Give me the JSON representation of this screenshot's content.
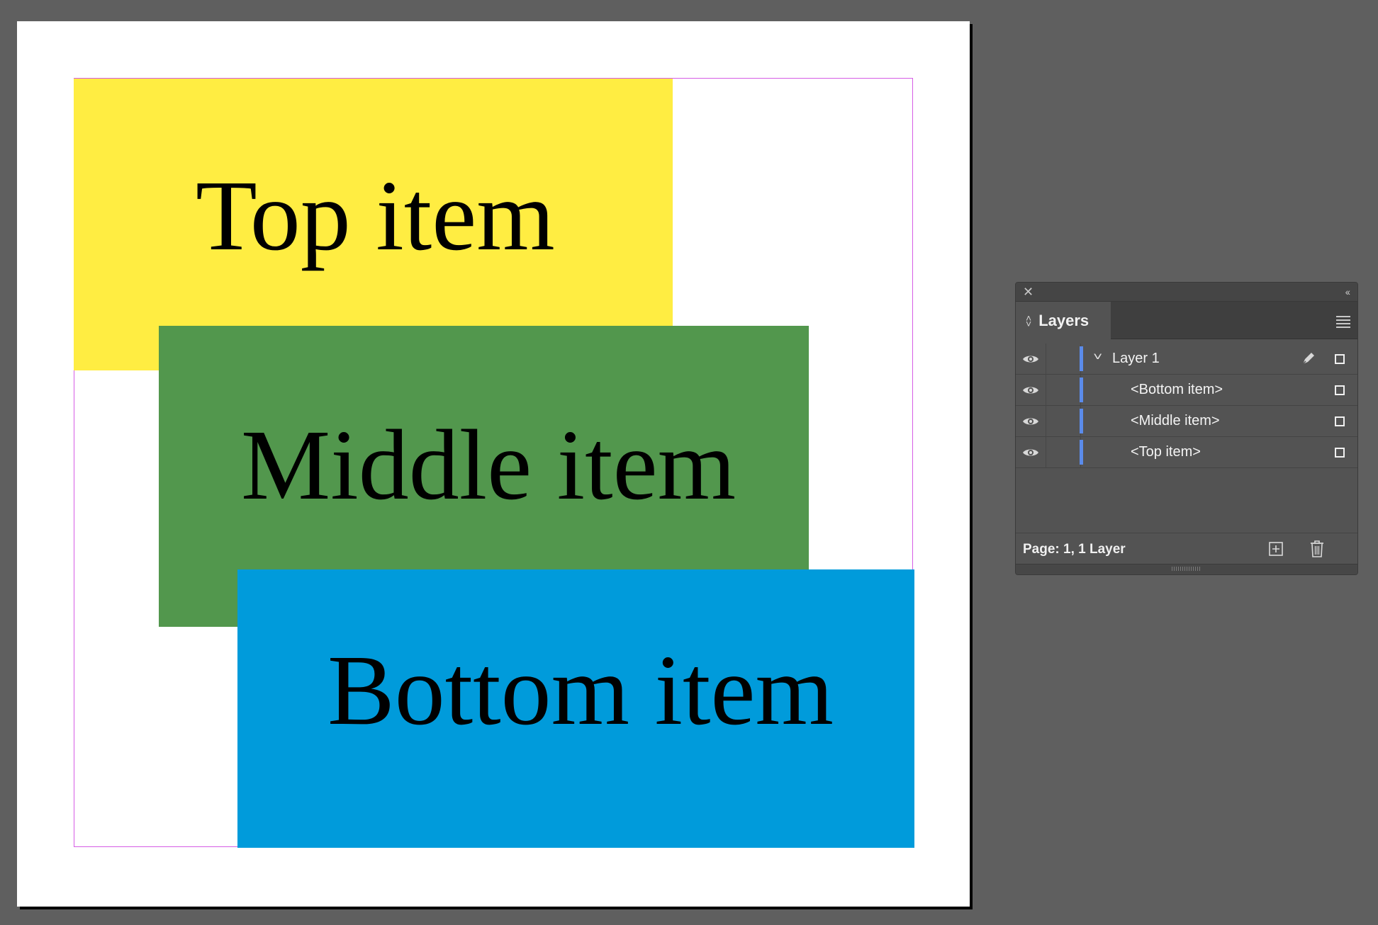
{
  "canvas": {
    "frames": [
      {
        "label": "Top item",
        "fill": "#ffed42"
      },
      {
        "label": "Middle item",
        "fill": "#52974d"
      },
      {
        "label": "Bottom item",
        "fill": "#009bdb"
      }
    ],
    "margin_guide_color": "#d65ce6"
  },
  "layers_panel": {
    "tab_label": "Layers",
    "rows": [
      {
        "label": "Layer 1",
        "visible": true,
        "expanded": true,
        "icon": "pen-icon"
      },
      {
        "label": "<Bottom item>",
        "visible": true
      },
      {
        "label": "<Middle item>",
        "visible": true
      },
      {
        "label": "<Top item>",
        "visible": true
      }
    ],
    "layer_color": "#5b8bea",
    "status": "Page: 1, 1 Layer"
  }
}
